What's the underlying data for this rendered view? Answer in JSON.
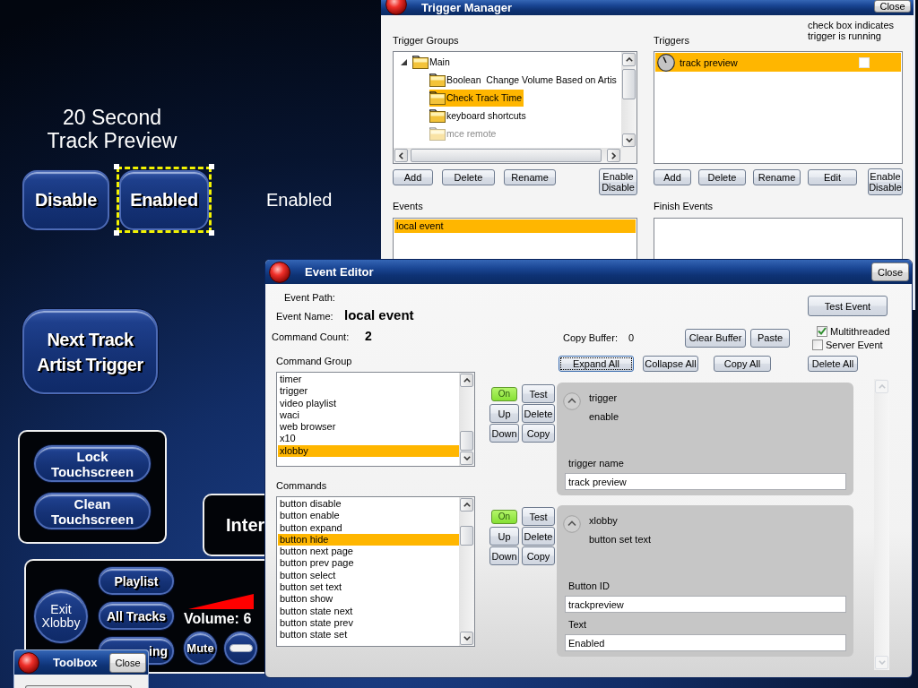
{
  "trigger_manager": {
    "title": "Trigger Manager",
    "close": "Close",
    "groups": {
      "label": "Trigger Groups",
      "tree": [
        {
          "label": "Main",
          "expanded": true,
          "selected": false,
          "disabled": false,
          "children": [
            {
              "label": "Boolean  Change Volume Based on Artis",
              "selected": false,
              "disabled": false
            },
            {
              "label": "Check Track Time",
              "selected": true,
              "disabled": false
            },
            {
              "label": "keyboard shortcuts",
              "selected": false,
              "disabled": false
            },
            {
              "label": "mce remote",
              "selected": false,
              "disabled": true
            }
          ]
        }
      ],
      "buttons": [
        "Add",
        "Delete",
        "Rename",
        "Enable\nDisable"
      ]
    },
    "triggers": {
      "label": "Triggers",
      "note": "check box indicates\ntrigger is running",
      "items": [
        {
          "label": "track preview",
          "selected": true,
          "checked": false
        }
      ],
      "buttons": [
        "Add",
        "Delete",
        "Rename",
        "Edit",
        "Enable\nDisable"
      ]
    },
    "events": {
      "label": "Events",
      "items": [
        {
          "label": "local event",
          "selected": true
        }
      ]
    },
    "finish_events": {
      "label": "Finish Events"
    }
  },
  "canvas": {
    "preview_title": "20 Second\nTrack Preview",
    "state_buttons": [
      {
        "label": "Disable",
        "selected": false
      },
      {
        "label": "Enabled",
        "selected": true
      }
    ],
    "state_text": "Enabled",
    "next_track_button": "Next Track\nArtist Trigger",
    "touchscreen_buttons": [
      "Lock\nTouchscreen",
      "Clean\nTouchscreen"
    ],
    "internet_panel_text": "Inter",
    "player": {
      "exit_button": "Exit\nXlobby",
      "nav_buttons": [
        "Playlist",
        "All Tracks",
        "ing"
      ],
      "volume_reading": "Volume: 6",
      "mute_button": "Mute"
    }
  },
  "event_editor": {
    "title": "Event Editor",
    "close": "Close",
    "event_path_label": "Event Path:",
    "event_name_label": "Event Name:",
    "event_name": "local event",
    "command_count_label": "Command Count:",
    "command_count": "2",
    "copy_buffer_label": "Copy Buffer:",
    "copy_buffer": "0",
    "test_event_button": "Test Event",
    "buffer_buttons": [
      "Clear Buffer",
      "Paste"
    ],
    "options": [
      {
        "label": "Multithreaded",
        "checked": true
      },
      {
        "label": "Server Event",
        "checked": false
      }
    ],
    "list_buttons": [
      {
        "label": "Expand All",
        "focused": true
      },
      {
        "label": "Collapse All",
        "focused": false
      },
      {
        "label": "Copy All",
        "focused": false
      }
    ],
    "delete_all_button": "Delete All",
    "command_group": {
      "label": "Command Group",
      "items": [
        {
          "label": "timer",
          "selected": false
        },
        {
          "label": "trigger",
          "selected": false
        },
        {
          "label": "video playlist",
          "selected": false
        },
        {
          "label": "waci",
          "selected": false
        },
        {
          "label": "web browser",
          "selected": false
        },
        {
          "label": "x10",
          "selected": false
        },
        {
          "label": "xlobby",
          "selected": true
        }
      ]
    },
    "commands": {
      "label": "Commands",
      "items": [
        {
          "label": "button disable",
          "selected": false
        },
        {
          "label": "button enable",
          "selected": false
        },
        {
          "label": "button expand",
          "selected": false
        },
        {
          "label": "button hide",
          "selected": true
        },
        {
          "label": "button next page",
          "selected": false
        },
        {
          "label": "button prev page",
          "selected": false
        },
        {
          "label": "button select",
          "selected": false
        },
        {
          "label": "button set text",
          "selected": false
        },
        {
          "label": "button show",
          "selected": false
        },
        {
          "label": "button state next",
          "selected": false
        },
        {
          "label": "button state prev",
          "selected": false
        },
        {
          "label": "button state set",
          "selected": false
        }
      ]
    },
    "command_cards": [
      {
        "buttons": [
          {
            "label": "On",
            "kind": "toggle",
            "on": true
          },
          {
            "label": "Test",
            "kind": "push"
          },
          {
            "label": "Up",
            "kind": "push"
          },
          {
            "label": "Delete",
            "kind": "push"
          },
          {
            "label": "Down",
            "kind": "push"
          },
          {
            "label": "Copy",
            "kind": "push"
          }
        ],
        "expanded": true,
        "group": "trigger",
        "command": "enable",
        "fields": [
          {
            "label": "trigger name",
            "value": "track preview"
          }
        ]
      },
      {
        "buttons": [
          {
            "label": "On",
            "kind": "toggle",
            "on": true
          },
          {
            "label": "Test",
            "kind": "push"
          },
          {
            "label": "Up",
            "kind": "push"
          },
          {
            "label": "Delete",
            "kind": "push"
          },
          {
            "label": "Down",
            "kind": "push"
          },
          {
            "label": "Copy",
            "kind": "push"
          }
        ],
        "expanded": true,
        "group": "xlobby",
        "command": "button set text",
        "fields": [
          {
            "label": "Button ID",
            "value": "trackpreview"
          },
          {
            "label": "Text",
            "value": "Enabled"
          }
        ]
      }
    ]
  },
  "toolbox": {
    "title": "Toolbox",
    "close": "Close"
  }
}
